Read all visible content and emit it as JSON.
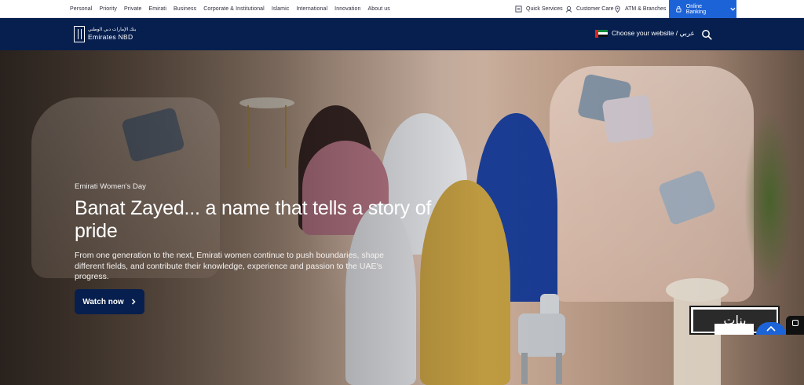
{
  "topbar": {
    "segments": [
      "Personal",
      "Priority",
      "Private",
      "Emirati",
      "Business",
      "Corporate & Institutional",
      "Islamic",
      "International",
      "Innovation",
      "About us"
    ],
    "quick_services": "Quick Services",
    "customer_care": "Customer Care",
    "atm_branches": "ATM & Branches",
    "online_banking": "Online Banking"
  },
  "header": {
    "logo_arabic": "بنك الإمارات دبي الوطني",
    "logo_english": "Emirates NBD",
    "choose_website": "Choose your website / عربي"
  },
  "hero": {
    "eyebrow": "Emirati Women's Day",
    "headline": "Banat Zayed... a name that tells a story of pride",
    "body": "From one generation to the next, Emirati women continue to push boundaries, shape different fields, and contribute their knowledge, experience and passion to the UAE's progress.",
    "cta": "Watch now",
    "promo_text": "بنات"
  },
  "colors": {
    "navy": "#071f4e",
    "brand_blue": "#1d63d8"
  }
}
